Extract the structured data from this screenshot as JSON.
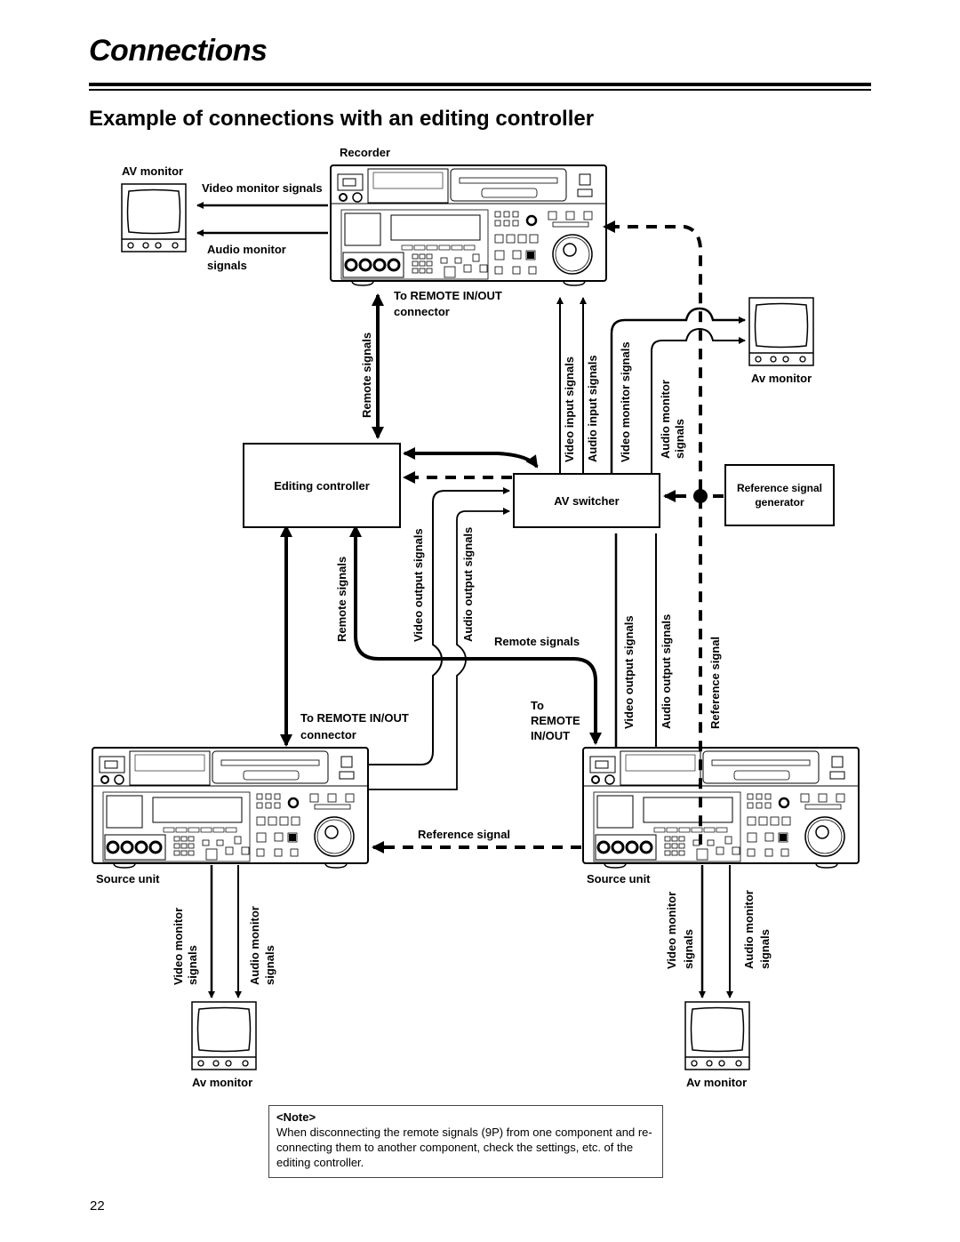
{
  "page": {
    "title": "Connections",
    "subtitle": "Example of connections with an editing controller",
    "page_number": "22"
  },
  "devices": {
    "recorder": "Recorder",
    "av_monitor_top_left": "AV monitor",
    "av_monitor_right": "Av monitor",
    "editing_controller": "Editing controller",
    "av_switcher": "AV switcher",
    "reference_generator_line1": "Reference signal",
    "reference_generator_line2": "generator",
    "source_unit_left": "Source unit",
    "source_unit_right": "Source unit",
    "av_monitor_bottom_left": "Av monitor",
    "av_monitor_bottom_right": "Av monitor"
  },
  "signals": {
    "video_monitor_signals": "Video monitor signals",
    "audio_monitor_line1": "Audio monitor",
    "audio_monitor_line2": "signals",
    "to_remote_top_line1": "To REMOTE IN/OUT",
    "to_remote_top_line2": "connector",
    "remote_signals_top": "Remote signals",
    "video_input_signals": "Video input signals",
    "audio_input_signals": "Audio input signals",
    "video_monitor_signals_vert": "Video monitor signals",
    "audio_monitor_vert_line1": "Audio monitor",
    "audio_monitor_vert_line2": "signals",
    "remote_signals_left": "Remote signals",
    "video_output_signals_left": "Video output signals",
    "audio_output_signals_left": "Audio output signals",
    "remote_signals_horizontal": "Remote signals",
    "video_output_signals_right": "Video output signals",
    "audio_output_signals_right": "Audio output signals",
    "reference_signal_vert": "Reference signal",
    "to_remote_left_line1": "To REMOTE IN/OUT",
    "to_remote_left_line2": "connector",
    "to_remote_right_line1": "To",
    "to_remote_right_line2": "REMOTE",
    "to_remote_right_line3": "IN/OUT",
    "reference_signal_horizontal": "Reference signal",
    "src_left_video_line1": "Video monitor",
    "src_left_video_line2": "signals",
    "src_left_audio_line1": "Audio monitor",
    "src_left_audio_line2": "signals",
    "src_right_video_line1": "Video  monitor",
    "src_right_video_line2": "signals",
    "src_right_audio_line1": "Audio monitor",
    "src_right_audio_line2": "signals"
  },
  "note": {
    "heading": "<Note>",
    "text": "When disconnecting the remote signals (9P) from one component and re-connecting them to another component, check the settings, etc. of the editing controller."
  }
}
